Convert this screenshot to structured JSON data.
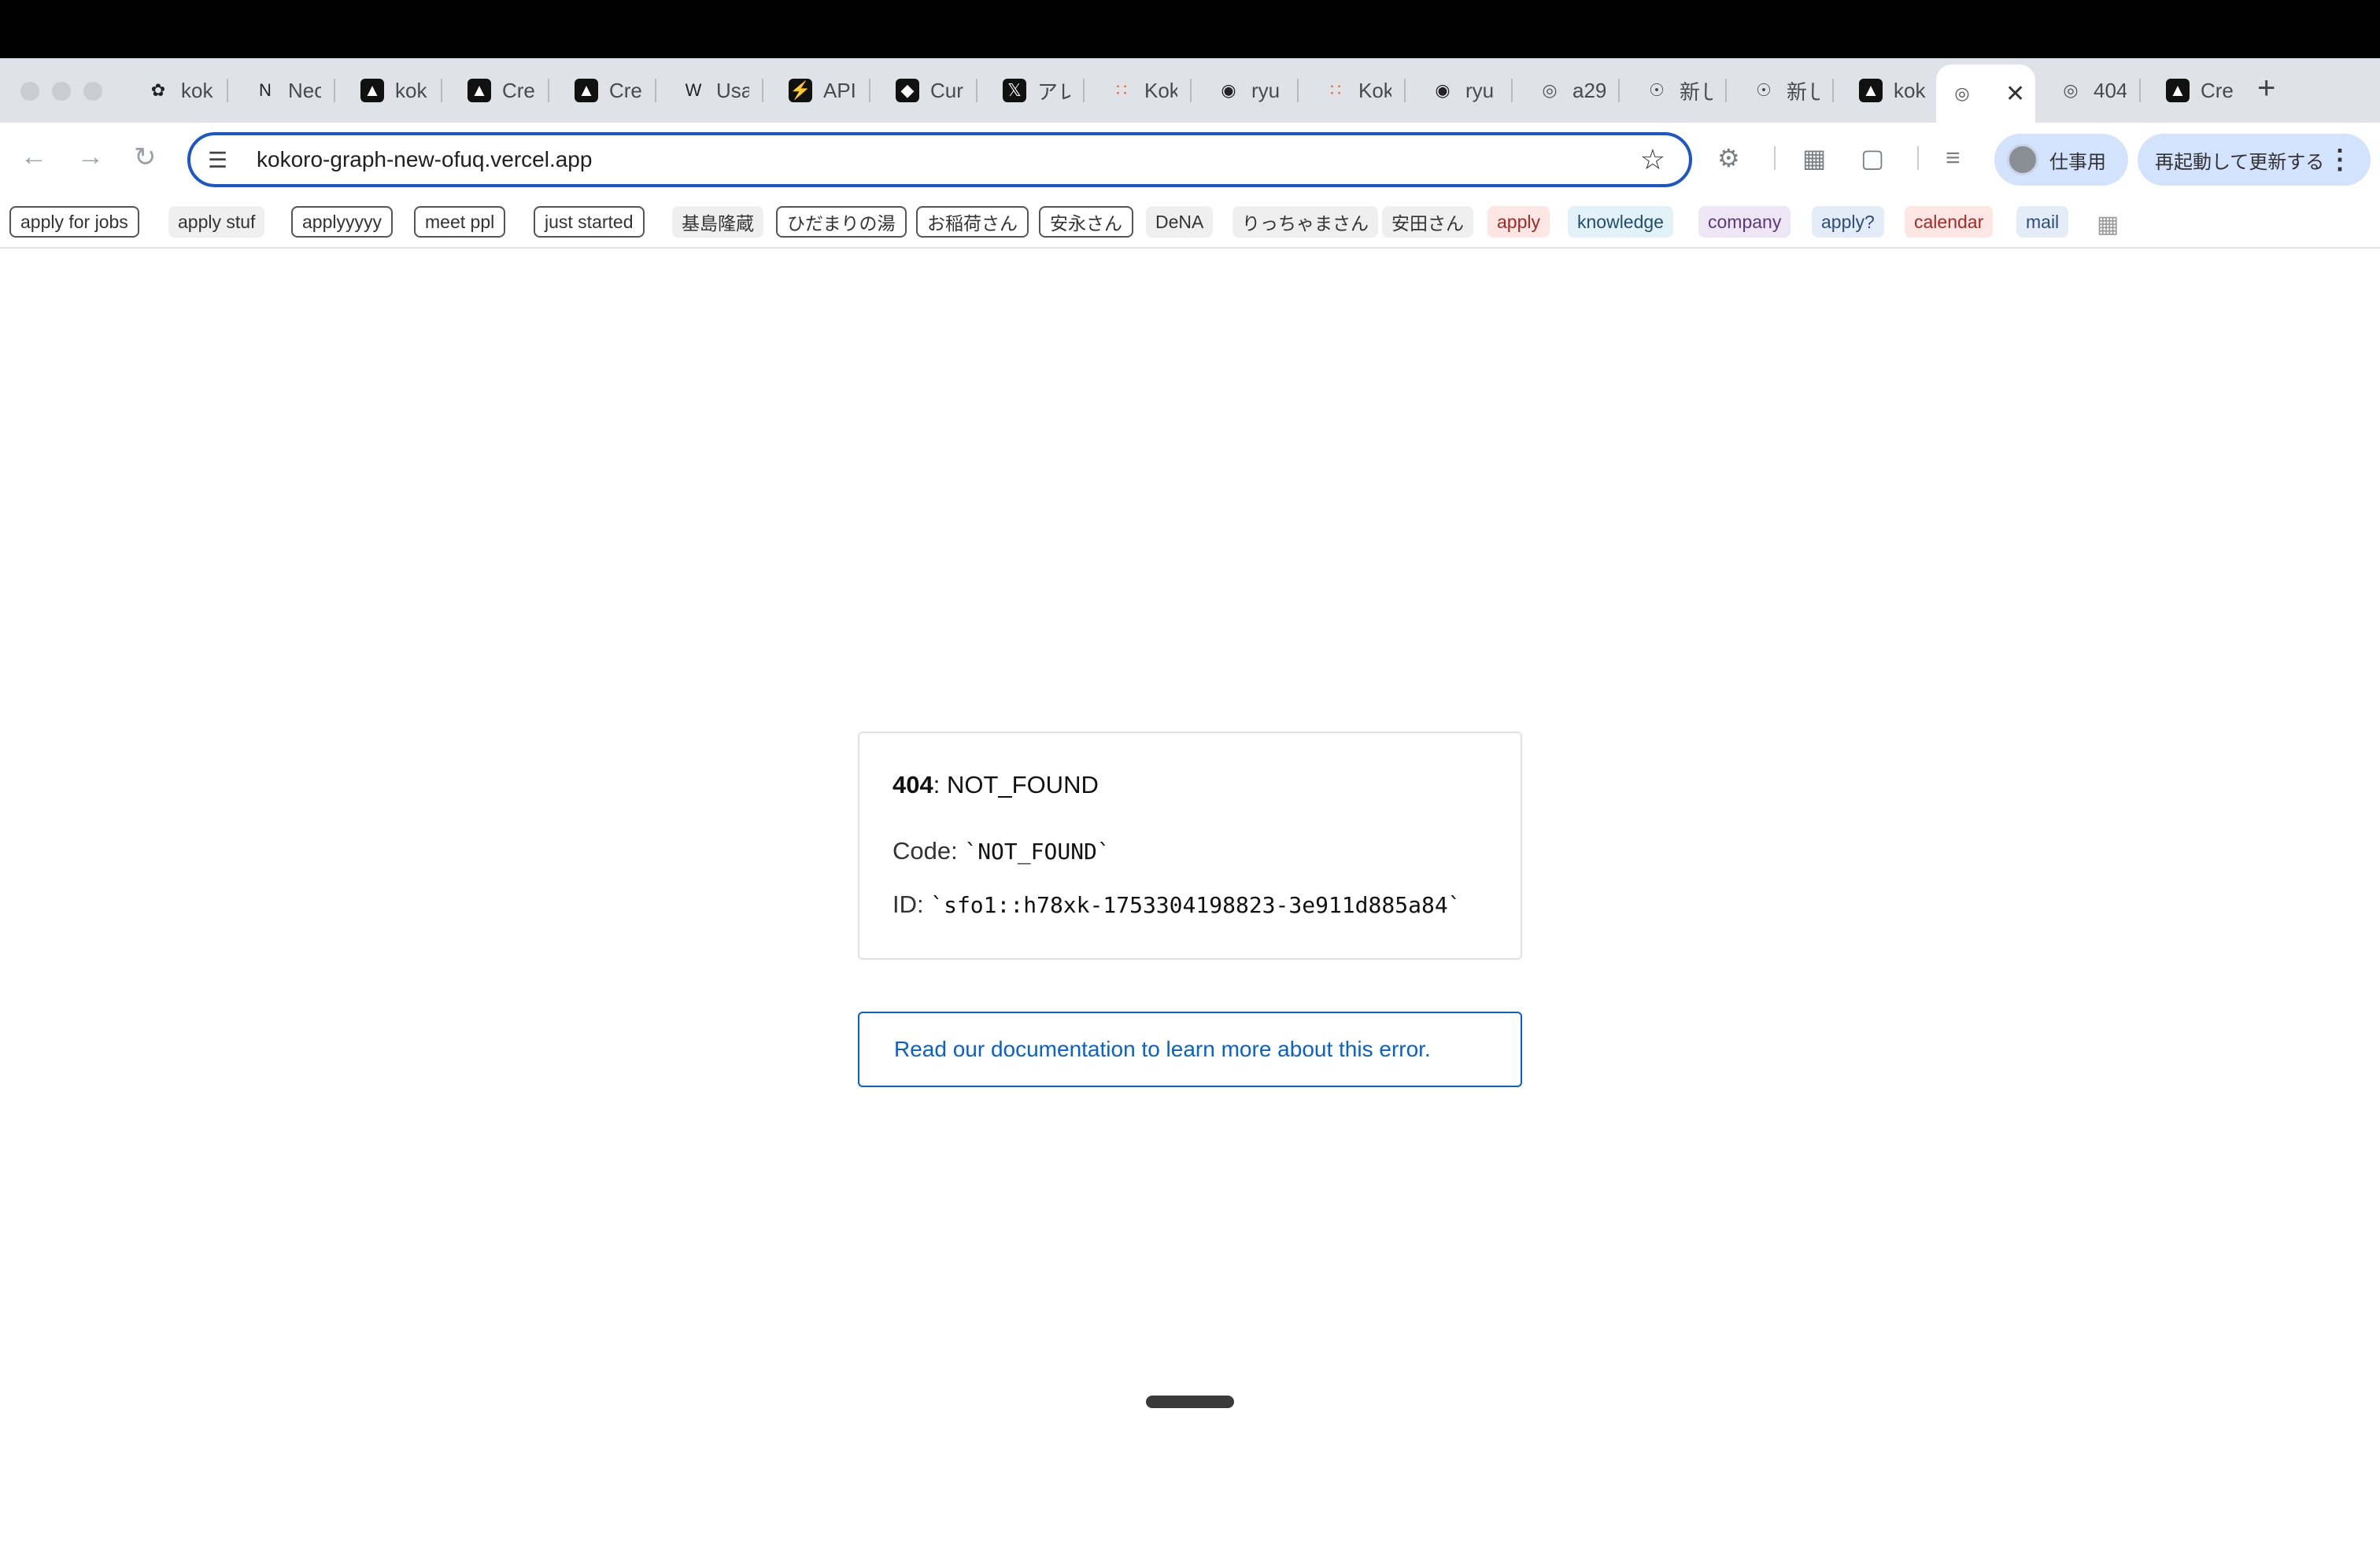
{
  "tabs": [
    {
      "label": "kok",
      "icon": "openai-icon"
    },
    {
      "label": "Neo",
      "icon": "notion-icon"
    },
    {
      "label": "kok",
      "icon": "vercel-icon"
    },
    {
      "label": "Cre",
      "icon": "vercel-icon"
    },
    {
      "label": "Cre",
      "icon": "vercel-icon"
    },
    {
      "label": "Usa",
      "icon": "w-icon"
    },
    {
      "label": "API",
      "icon": "bolt-icon"
    },
    {
      "label": "Cur",
      "icon": "cursor-icon"
    },
    {
      "label": "アレ",
      "icon": "x-icon"
    },
    {
      "label": "Kok",
      "icon": "dots-icon"
    },
    {
      "label": "ryu",
      "icon": "github-icon"
    },
    {
      "label": "Kok",
      "icon": "dots-icon"
    },
    {
      "label": "ryu",
      "icon": "github-icon"
    },
    {
      "label": "a29",
      "icon": "globe-icon"
    },
    {
      "label": "新し",
      "icon": "chrome-icon"
    },
    {
      "label": "新し",
      "icon": "chrome-icon"
    },
    {
      "label": "kok",
      "icon": "vercel-icon"
    },
    {
      "label": "",
      "icon": "globe-icon",
      "active": true
    },
    {
      "label": "404",
      "icon": "globe-icon"
    },
    {
      "label": "Cre",
      "icon": "vercel-icon"
    }
  ],
  "toolbar": {
    "url": "kokoro-graph-new-ofuq.vercel.app",
    "profile_label": "仕事用",
    "restart_label": "再起動して更新する"
  },
  "bookmarks": [
    {
      "label": "apply for jobs",
      "style": "boxed"
    },
    {
      "label": "apply stuf",
      "style": "gray"
    },
    {
      "label": "applyyyyy",
      "style": "boxed"
    },
    {
      "label": "meet ppl",
      "style": "boxed"
    },
    {
      "label": "just started",
      "style": "boxed"
    },
    {
      "label": "基島隆蔵",
      "style": "gray"
    },
    {
      "label": "ひだまりの湯",
      "style": "boxed"
    },
    {
      "label": "お稲荷さん",
      "style": "boxed"
    },
    {
      "label": "安永さん",
      "style": "boxed"
    },
    {
      "label": "DeNA",
      "style": "gray"
    },
    {
      "label": "りっちゃまさん",
      "style": "gray"
    },
    {
      "label": "安田さん",
      "style": "gray"
    },
    {
      "label": "apply",
      "style": "red"
    },
    {
      "label": "knowledge",
      "style": "blue"
    },
    {
      "label": "company",
      "style": "purple"
    },
    {
      "label": "apply?",
      "style": "lblue"
    },
    {
      "label": "calendar",
      "style": "red"
    },
    {
      "label": "mail",
      "style": "lblue"
    }
  ],
  "error": {
    "status": "404",
    "status_text": ": NOT_FOUND",
    "code_label": "Code: ",
    "code_value": "`NOT_FOUND`",
    "id_label": "ID: ",
    "id_value": "`sfo1::h78xk-1753304198823-3e911d885a84`",
    "doc_link": "Read our documentation to learn more about this error."
  },
  "colors": {
    "accent": "#0761d1",
    "omnibox_border": "#1a57c8",
    "tabstrip": "#dfe3e7"
  }
}
